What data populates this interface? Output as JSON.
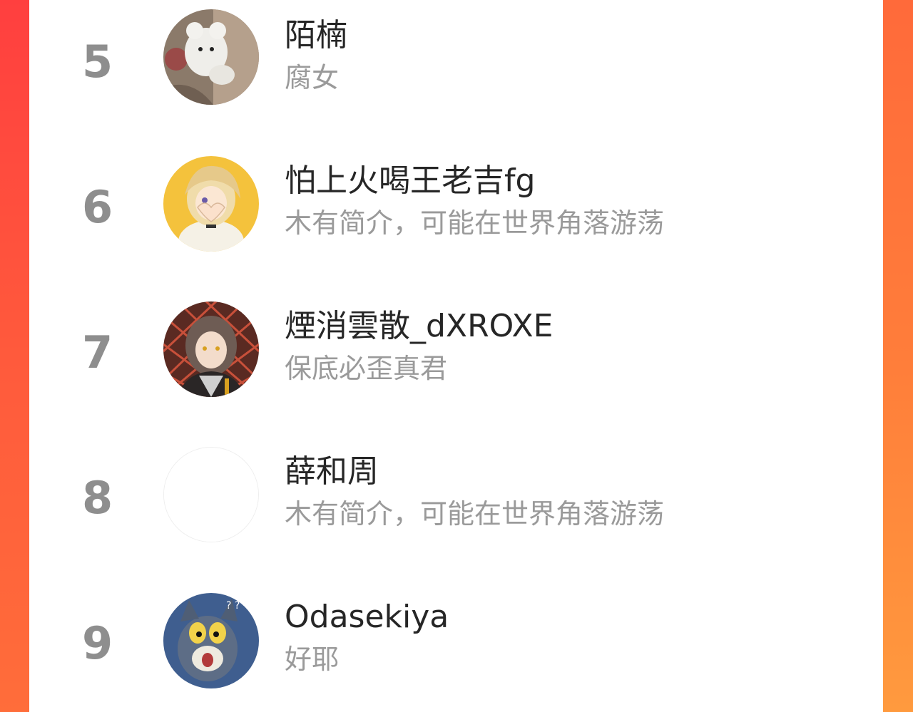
{
  "colors": {
    "rank": "#8e8e8e",
    "name": "#262626",
    "bio": "#9a9a9a",
    "accent_left": "#ff4a3d",
    "accent_right": "#ff8a3c"
  },
  "ranking": [
    {
      "rank": "5",
      "name": "陌楠",
      "bio": "腐女",
      "avatar": "plush-bear-avatar"
    },
    {
      "rank": "6",
      "name": "怕上火喝王老吉fg",
      "bio": "木有简介，可能在世界角落游荡",
      "avatar": "anime-heart-hands-avatar"
    },
    {
      "rank": "7",
      "name": "煙消雲散_dXROXE",
      "bio": "保底必歪真君",
      "avatar": "anime-character-avatar"
    },
    {
      "rank": "8",
      "name": "薛和周",
      "bio": "木有简介，可能在世界角落游荡",
      "avatar": "blank-avatar"
    },
    {
      "rank": "9",
      "name": "Odasekiya",
      "bio": "好耶",
      "avatar": "cartoon-cat-avatar"
    }
  ]
}
